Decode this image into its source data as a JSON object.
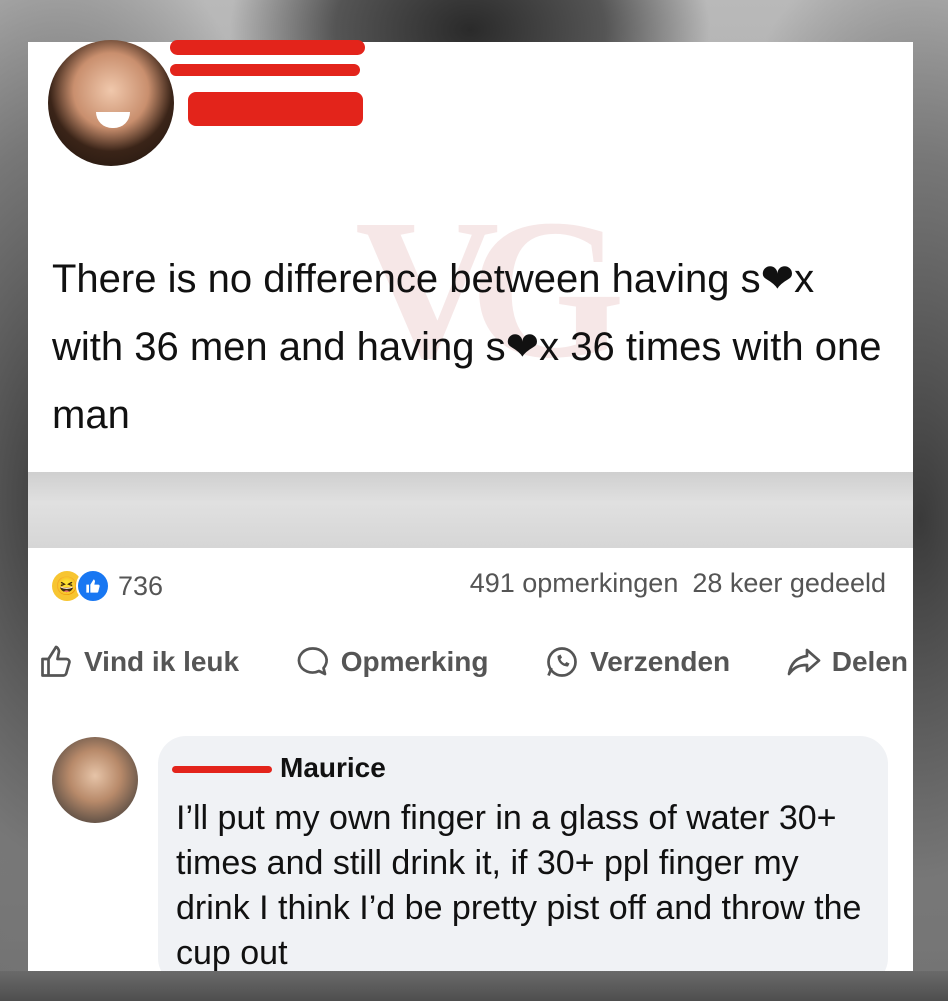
{
  "post": {
    "text": "There is no difference between having s❤x with 36 men and having s❤x 36 times with one man",
    "watermark": "VG"
  },
  "stats": {
    "reaction_count": "736",
    "comments": "491 opmerkingen",
    "shares": "28 keer gedeeld"
  },
  "actions": {
    "like": "Vind ik leuk",
    "comment": "Opmerking",
    "send": "Verzenden",
    "share": "Delen"
  },
  "comment": {
    "name": "Maurice",
    "text": "I’ll put my own finger in a glass of water 30+ times and still drink it, if 30+ ppl finger my drink I think I’d be pretty pist off and throw the cup out"
  },
  "colors": {
    "redaction": "#e3241b",
    "like_blue": "#1877f2",
    "haha_yellow": "#f7c531"
  }
}
